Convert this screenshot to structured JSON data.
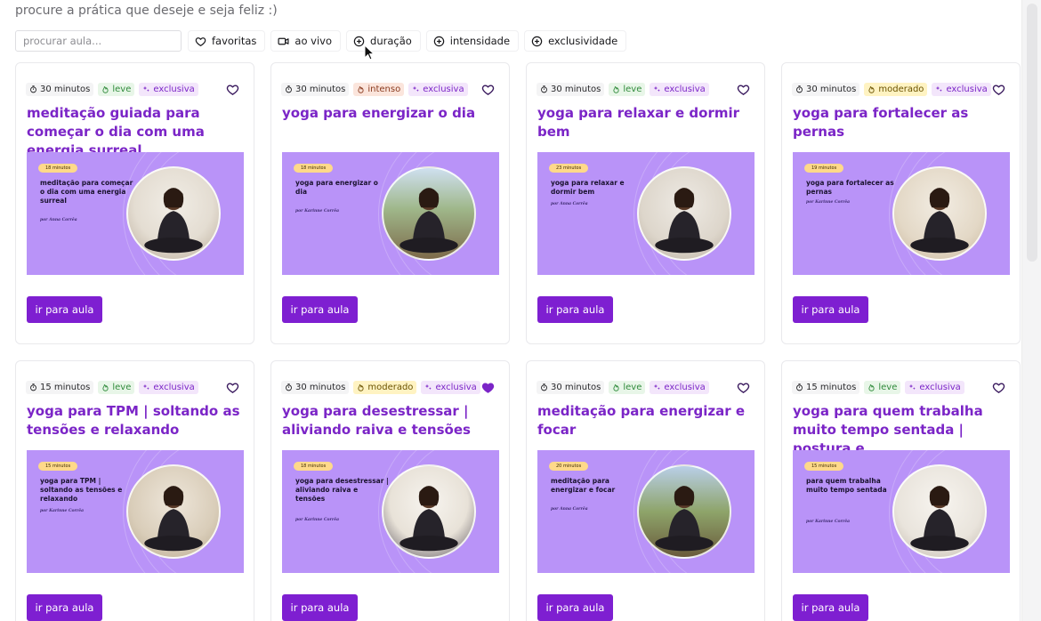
{
  "header": {
    "subtitle": "procure a prática que deseje e seja feliz :)"
  },
  "search": {
    "placeholder": "procurar aula..."
  },
  "filters": [
    {
      "label": "favoritas",
      "icon": "heart-icon"
    },
    {
      "label": "ao vivo",
      "icon": "video-icon"
    },
    {
      "label": "duração",
      "icon": "plus-circle-icon"
    },
    {
      "label": "intensidade",
      "icon": "plus-circle-icon"
    },
    {
      "label": "exclusividade",
      "icon": "plus-circle-icon"
    }
  ],
  "cards": [
    {
      "duration": "30 minutos",
      "intensity": "leve",
      "exclusive": "exclusiva",
      "favorite": false,
      "title": "meditação guiada para começar o dia com uma energia surreal",
      "thumb": {
        "pill": "18 minutos",
        "title": "meditação para começar o dia com uma energia surreal",
        "author": "por Anna Corrêa"
      },
      "cta": "ir para aula"
    },
    {
      "duration": "30 minutos",
      "intensity": "intenso",
      "exclusive": "exclusiva",
      "favorite": false,
      "title": "yoga para energizar o dia",
      "thumb": {
        "pill": "18 minutos",
        "title": "yoga para energizar o dia",
        "author": "por Karinne Corrêa"
      },
      "cta": "ir para aula"
    },
    {
      "duration": "30 minutos",
      "intensity": "leve",
      "exclusive": "exclusiva",
      "favorite": false,
      "title": "yoga para relaxar e dormir bem",
      "thumb": {
        "pill": "23 minutos",
        "title": "yoga para relaxar e dormir bem",
        "author": "por Anna Corrêa"
      },
      "cta": "ir para aula"
    },
    {
      "duration": "30 minutos",
      "intensity": "moderado",
      "exclusive": "exclusiva",
      "favorite": false,
      "title": "yoga para fortalecer as pernas",
      "thumb": {
        "pill": "19 minutos",
        "title": "yoga para fortalecer as pernas",
        "author": "por Karinne Corrêa"
      },
      "cta": "ir para aula"
    },
    {
      "duration": "15 minutos",
      "intensity": "leve",
      "exclusive": "exclusiva",
      "favorite": false,
      "title": "yoga para TPM | soltando as tensões e relaxando",
      "thumb": {
        "pill": "15 minutos",
        "title": "yoga para TPM | soltando as tensões e relaxando",
        "author": "por Karinne Corrêa"
      },
      "cta": "ir para aula"
    },
    {
      "duration": "30 minutos",
      "intensity": "moderado",
      "exclusive": "exclusiva",
      "favorite": true,
      "title": "yoga para desestressar | aliviando raiva e tensões",
      "thumb": {
        "pill": "18 minutos",
        "title": "yoga para desestressar | aliviando raiva e tensões",
        "author": "por Karinne Corrêa"
      },
      "cta": "ir para aula"
    },
    {
      "duration": "30 minutos",
      "intensity": "leve",
      "exclusive": "exclusiva",
      "favorite": false,
      "title": "meditação para energizar e focar",
      "thumb": {
        "pill": "20 minutos",
        "title": "meditação para energizar e focar",
        "author": "por Anna Corrêa"
      },
      "cta": "ir para aula"
    },
    {
      "duration": "15 minutos",
      "intensity": "leve",
      "exclusive": "exclusiva",
      "favorite": false,
      "title": "yoga para quem trabalha muito tempo sentada | postura e...",
      "thumb": {
        "pill": "15 minutos",
        "title": "para quem trabalha muito tempo sentada",
        "author": "por Karinne Corrêa"
      },
      "cta": "ir para aula"
    }
  ],
  "colors": {
    "brand": "#7e1fd1",
    "thumb_bg": "#b993f8",
    "favorite": "#7b25c7"
  }
}
